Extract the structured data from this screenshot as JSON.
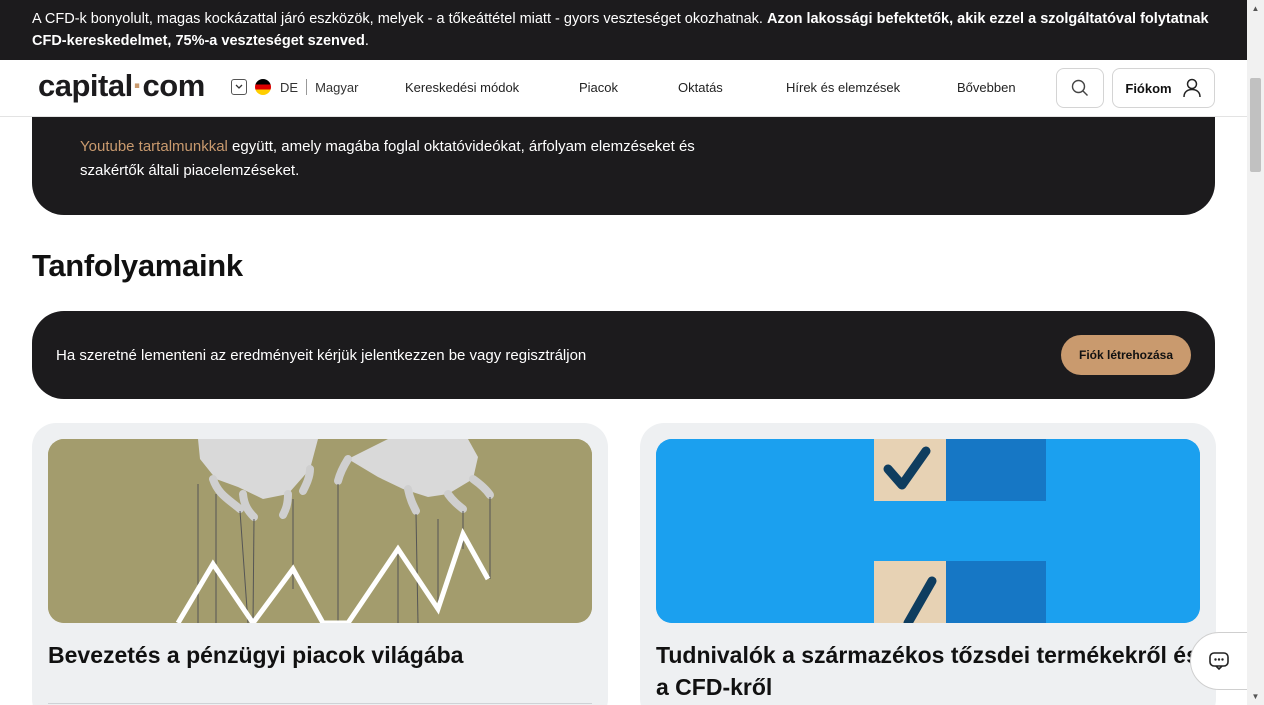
{
  "risk_banner": {
    "text_normal": "A CFD-k bonyolult, magas kockázattal járó eszközök, melyek - a tőkeáttétel miatt - gyors veszteséget okozhatnak. ",
    "text_bold": "Azon lakossági befektetők, akik ezzel a szolgáltatóval folytatnak CFD-kereskedelmet, 75%-a veszteséget szenved",
    "text_end": "."
  },
  "header": {
    "logo_left": "capital",
    "logo_dot": "·",
    "logo_right": "com",
    "lang_code": "DE",
    "lang_name": "Magyar",
    "nav": [
      "Kereskedési módok",
      "Piacok",
      "Oktatás",
      "Hírek és elemzések",
      "Bővebben"
    ],
    "account_label": "Fiókom"
  },
  "intro": {
    "link_text": "Youtube tartalmunkkal",
    "text_line1": " együtt, amely magába foglal oktatóvideókat, árfolyam elemzéseket és",
    "text_line2": "szakértők általi piacelemzéseket."
  },
  "section": {
    "title": "Tanfolyamaink"
  },
  "login_bar": {
    "text": "Ha szeretné lementeni az eredményeit kérjük jelentkezzen be vagy regisztráljon",
    "button": "Fiók létrehozása"
  },
  "courses": [
    {
      "title": "Bevezetés a pénzügyi piacok világába"
    },
    {
      "title": "Tudnivalók a származékos tőzsdei termékekről és a CFD-kről"
    }
  ],
  "colors": {
    "dark": "#1c1b1d",
    "accent": "#c99a6e",
    "card_bg": "#eef0f2"
  }
}
